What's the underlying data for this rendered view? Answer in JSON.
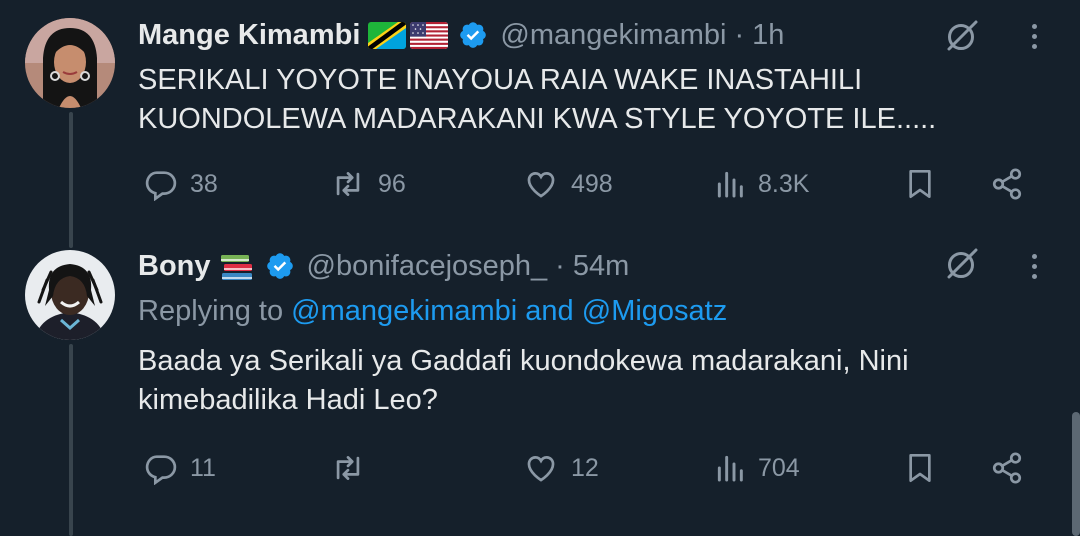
{
  "tweet1": {
    "display_name": "Mange Kimambi",
    "flags": [
      "tanzania-flag",
      "us-flag"
    ],
    "handle": "@mangekimambi",
    "separator": "·",
    "time": "1h",
    "text": "SERIKALI YOYOTE INAYOUA RAIA WAKE INASTAHILI KUONDOLEWA MADARAKANI KWA STYLE YOYOTE ILE.....",
    "stats": {
      "replies": "38",
      "reposts": "96",
      "likes": "498",
      "views": "8.3K"
    }
  },
  "tweet2": {
    "display_name": "Bony",
    "emoji": "books-emoji",
    "handle": "@bonifacejoseph_",
    "separator": "·",
    "time": "54m",
    "replying_prefix": "Replying to",
    "replying_to_1": "@mangekimambi",
    "replying_and": "and",
    "replying_to_2": "@Migosatz",
    "text": "Baada ya Serikali ya Gaddafi kuondokewa madarakani, Nini kimebadilika Hadi Leo?",
    "stats": {
      "replies": "11",
      "reposts": "",
      "likes": "12",
      "views": "704"
    }
  },
  "colors": {
    "background": "#15202b",
    "text": "#e7e9ea",
    "muted": "#8b98a5",
    "accent": "#1d9bf0",
    "thread_line": "#38444d"
  }
}
